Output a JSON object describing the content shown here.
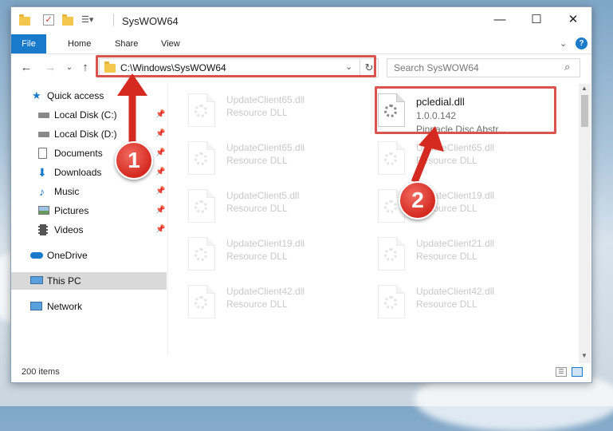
{
  "window": {
    "title": "SysWOW64",
    "controls": {
      "minimize": "—",
      "maximize": "☐",
      "close": "✕"
    }
  },
  "ribbon": {
    "tabs": [
      "File",
      "Home",
      "Share",
      "View"
    ],
    "accent": "#1979ca"
  },
  "address": {
    "path": "C:\\Windows\\SysWOW64",
    "search_placeholder": "Search SysWOW64"
  },
  "sidebar": {
    "quick_access": "Quick access",
    "items": [
      {
        "label": "Local Disk (C:)",
        "icon": "drive-icon",
        "pinned": true
      },
      {
        "label": "Local Disk (D:)",
        "icon": "drive-icon",
        "pinned": true
      },
      {
        "label": "Documents",
        "icon": "documents-icon",
        "pinned": true
      },
      {
        "label": "Downloads",
        "icon": "downloads-icon",
        "pinned": true
      },
      {
        "label": "Music",
        "icon": "music-icon",
        "pinned": true
      },
      {
        "label": "Pictures",
        "icon": "pictures-icon",
        "pinned": true
      },
      {
        "label": "Videos",
        "icon": "videos-icon",
        "pinned": true
      }
    ],
    "onedrive": "OneDrive",
    "this_pc": "This PC",
    "network": "Network"
  },
  "files": [
    {
      "name": "UpdateClient65.dll",
      "sub1": "Resource DLL",
      "faded": true
    },
    {
      "name": "pcledial.dll",
      "sub1": "1.0.0.142",
      "sub2": "Pinnacle Disc Abstr...",
      "faded": false
    },
    {
      "name": "UpdateClient65.dll",
      "sub1": "Resource DLL",
      "faded": true
    },
    {
      "name": "UpdateClient65.dll",
      "sub1": "Resource DLL",
      "faded": true
    },
    {
      "name": "UpdateClient5.dll",
      "sub1": "Resource DLL",
      "faded": true
    },
    {
      "name": "UpdateClient19.dll",
      "sub1": "Resource DLL",
      "faded": true
    },
    {
      "name": "UpdateClient19.dll",
      "sub1": "Resource DLL",
      "faded": true
    },
    {
      "name": "UpdateClient21.dll",
      "sub1": "Resource DLL",
      "faded": true
    },
    {
      "name": "UpdateClient42.dll",
      "sub1": "Resource DLL",
      "faded": true
    },
    {
      "name": "UpdateClient42.dll",
      "sub1": "Resource DLL",
      "faded": true
    }
  ],
  "status": {
    "item_count": "200 items"
  },
  "annotations": {
    "step1": "1",
    "step2": "2",
    "highlight_color": "#d9534f"
  }
}
